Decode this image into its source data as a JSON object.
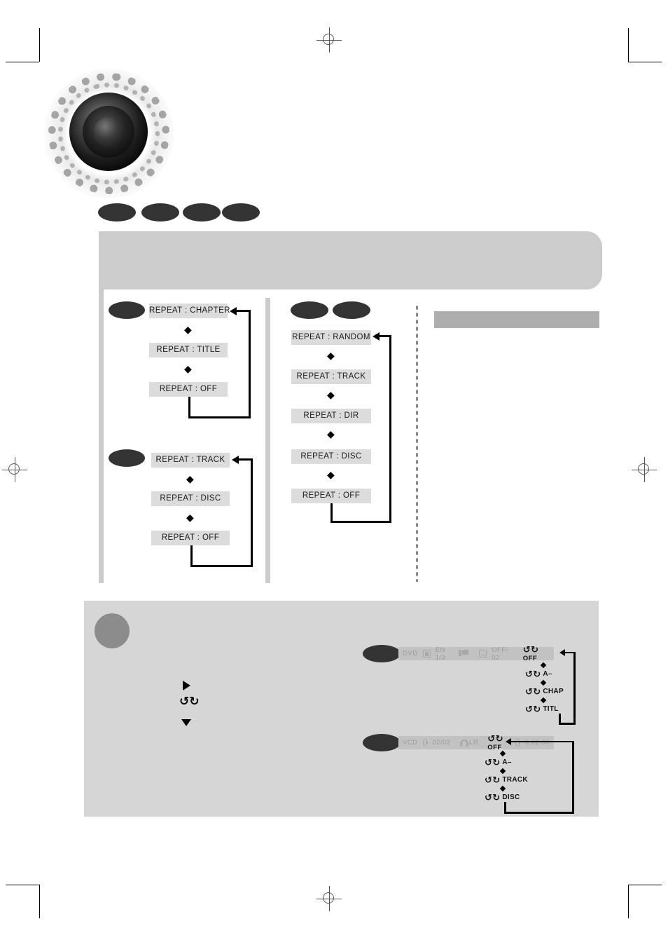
{
  "page": {
    "background_color": "#ffffff",
    "panel_gray": "#d6d6d6",
    "box_gray": "#dcdcdc",
    "badge_color": "#333333",
    "heading_bar_color": "#aeaeae"
  },
  "artwork": {
    "speaker_label": "speaker-binary-artwork",
    "binary_ring_text": "01010101001010101010010101101010101001010101"
  },
  "header": {
    "title": "",
    "body": "",
    "disc_badges": [
      {
        "label": "",
        "name": "disc-badge-dvd"
      },
      {
        "label": "",
        "name": "disc-badge-vcd"
      },
      {
        "label": "",
        "name": "disc-badge-cd"
      },
      {
        "label": "",
        "name": "disc-badge-mp3"
      }
    ]
  },
  "diagrams": {
    "left_column": [
      {
        "badges": [
          ""
        ],
        "badge_names": [
          "disc-badge-dvd"
        ],
        "steps": [
          "REPEAT : CHAPTER",
          "REPEAT : TITLE",
          "REPEAT : OFF"
        ],
        "loop_back_to": "REPEAT : CHAPTER"
      },
      {
        "badges": [
          ""
        ],
        "badge_names": [
          "disc-badge-cd"
        ],
        "steps": [
          "REPEAT : TRACK",
          "REPEAT : DISC",
          "REPEAT : OFF"
        ],
        "loop_back_to": "REPEAT : TRACK"
      }
    ],
    "middle_column": [
      {
        "badges": [
          "",
          ""
        ],
        "badge_names": [
          "disc-badge-mp3",
          "disc-badge-wma"
        ],
        "steps": [
          "REPEAT : RANDOM",
          "REPEAT : TRACK",
          "REPEAT : DIR",
          "REPEAT : DISC",
          "REPEAT : OFF"
        ],
        "loop_back_to": "REPEAT : RANDOM"
      }
    ],
    "right_column": {
      "heading": "",
      "body": ""
    }
  },
  "note": {
    "bullet_label": "",
    "title": "",
    "body": "",
    "inline_icons": [
      {
        "name": "play-icon",
        "glyph": "▶"
      },
      {
        "name": "repeat-icon",
        "glyph": "↺"
      },
      {
        "name": "down-arrow-icon",
        "glyph": "▼"
      }
    ],
    "osd_examples": [
      {
        "badge": "",
        "badge_name": "disc-badge-dvd",
        "status_bar": {
          "disc_type": "DVD",
          "angle_icon": "angle-icon",
          "audio": "EN 1/3",
          "audio_format_icon": "dolby-digital-icon",
          "subtitle_icon": "subtitle-icon",
          "subtitle": "OFF/ 02",
          "repeat_icon": "repeat-icon",
          "repeat_value": "OFF"
        },
        "repeat_cycle": [
          "OFF",
          "A–",
          "CHAP",
          "TITL"
        ],
        "loop_back_to": "OFF"
      },
      {
        "badge": "",
        "badge_name": "disc-badge-vcd",
        "status_bar": {
          "disc_type": "VCD",
          "disc_icon": "disc-icon",
          "track": "02/02",
          "audio_icon": "headphone-icon",
          "audio": "LR",
          "repeat_icon": "repeat-icon",
          "repeat_value": "OFF",
          "time_icon": "clock-icon",
          "time": "0:02:00"
        },
        "repeat_cycle": [
          "OFF",
          "A–",
          "TRACK",
          "DISC"
        ],
        "loop_back_to": "OFF"
      }
    ]
  },
  "print_marks": {
    "registration_marks": 5,
    "crop_marks": 4
  }
}
